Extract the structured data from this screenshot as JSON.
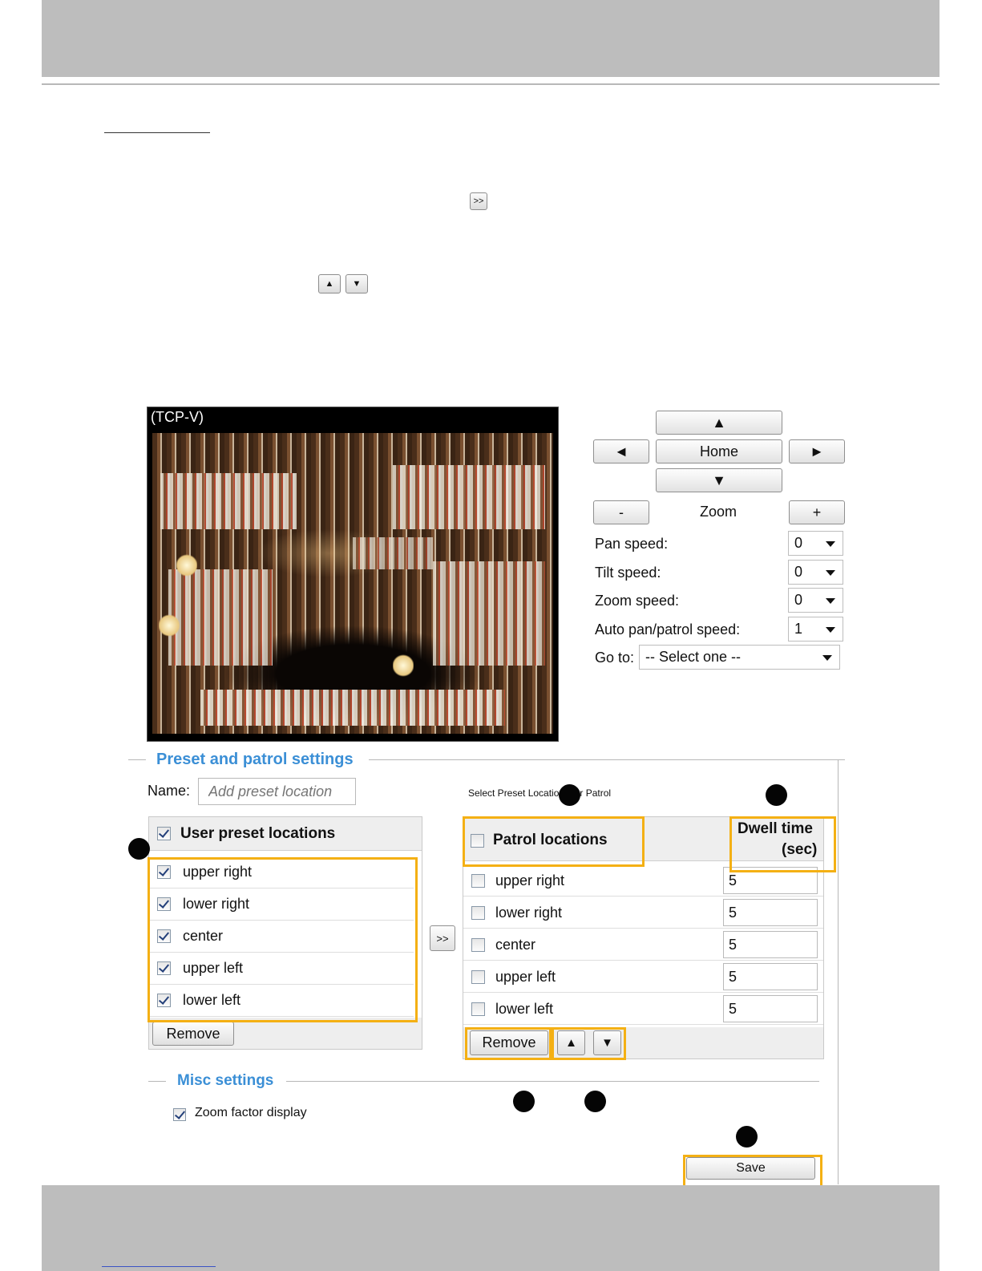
{
  "toolbar_demo": {
    "arrow_right_icon": "double-chevron-right",
    "up_icon": "up-triangle",
    "down_icon": "down-triangle",
    "arrow_glyph": ">>",
    "up_glyph": "▲",
    "down_glyph": "▼"
  },
  "video": {
    "title": "(TCP-V)"
  },
  "ptz": {
    "up": "▲",
    "down": "▼",
    "left": "◄",
    "right": "►",
    "home": "Home",
    "zoom_out": "-",
    "zoom_in": "+",
    "zoom_label": "Zoom",
    "pan_speed_label": "Pan speed:",
    "pan_speed_value": "0",
    "tilt_speed_label": "Tilt speed:",
    "tilt_speed_value": "0",
    "zoom_speed_label": "Zoom speed:",
    "zoom_speed_value": "0",
    "auto_speed_label": "Auto pan/patrol speed:",
    "auto_speed_value": "1",
    "goto_label": "Go to:",
    "goto_value": "-- Select one --"
  },
  "preset": {
    "legend": "Preset and patrol settings",
    "name_label": "Name:",
    "name_placeholder": "Add preset location",
    "patrol_caption": "Select Preset Locations for Patrol",
    "user_header": "User preset locations",
    "user_items": [
      "upper right",
      "lower right",
      "center",
      "upper left",
      "lower left"
    ],
    "remove_label": "Remove",
    "add_glyph": ">>",
    "patrol_header": "Patrol locations",
    "dwell_header_line1": "Dwell time",
    "dwell_header_line2": "(sec)",
    "patrol_items": [
      {
        "name": "upper right",
        "dwell": "5"
      },
      {
        "name": "lower right",
        "dwell": "5"
      },
      {
        "name": "center",
        "dwell": "5"
      },
      {
        "name": "upper left",
        "dwell": "5"
      },
      {
        "name": "lower left",
        "dwell": "5"
      }
    ],
    "patrol_remove_label": "Remove",
    "move_up": "▲",
    "move_down": "▼"
  },
  "misc": {
    "legend": "Misc settings",
    "zoom_factor_label": "Zoom factor display",
    "save_label": "Save"
  },
  "colors": {
    "accent": "#3b8fd6",
    "highlight": "#f4b014",
    "band": "#bdbdbd"
  }
}
